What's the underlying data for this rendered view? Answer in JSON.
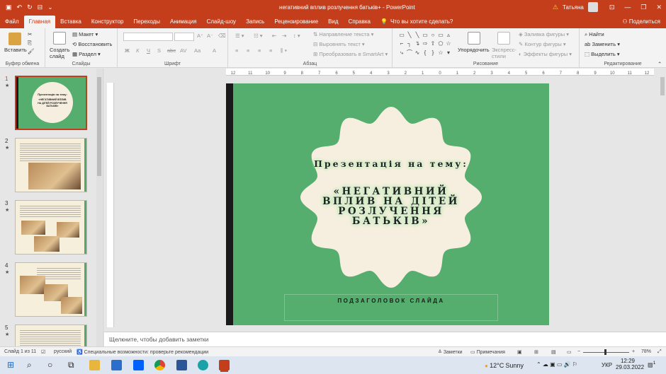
{
  "app": {
    "title": "негативний вплив розлучення батьків+ - PowerPoint",
    "user": "Татьяна"
  },
  "tabs": [
    "Файл",
    "Главная",
    "Вставка",
    "Конструктор",
    "Переходы",
    "Анимация",
    "Слайд-шоу",
    "Запись",
    "Рецензирование",
    "Вид",
    "Справка"
  ],
  "tell_me": "Что вы хотите сделать?",
  "share": "Поделиться",
  "ribbon": {
    "clipboard": {
      "paste": "Вставить",
      "label": "Буфер обмена"
    },
    "slides": {
      "new_slide": "Создать слайд",
      "layout": "Макет",
      "reset": "Восстановить",
      "section": "Раздел",
      "label": "Слайды"
    },
    "font": {
      "label": "Шрифт",
      "bold": "Ж",
      "italic": "К",
      "underline": "Ч",
      "strike": "S",
      "spacing": "AV",
      "case": "Aa",
      "color": "A"
    },
    "paragraph": {
      "label": "Абзац",
      "text_direction": "Направление текста",
      "align_text": "Выровнять текст",
      "smartart": "Преобразовать в SmartArt"
    },
    "drawing": {
      "label": "Рисование",
      "arrange": "Упорядочить",
      "quick_styles": "Экспресс-стили",
      "fill": "Заливка фигуры",
      "outline": "Контур фигуры",
      "effects": "Эффекты фигуры"
    },
    "editing": {
      "label": "Редактирование",
      "find": "Найти",
      "replace": "Заменить",
      "select": "Выделить"
    }
  },
  "ruler_ticks": [
    "12",
    "11",
    "10",
    "9",
    "8",
    "7",
    "6",
    "5",
    "4",
    "3",
    "2",
    "1",
    "0",
    "1",
    "2",
    "3",
    "4",
    "5",
    "6",
    "7",
    "8",
    "9",
    "10",
    "11",
    "12"
  ],
  "slide": {
    "presentation_on": "Презентація на тему:",
    "title_lines": [
      "«НЕГАТИВНИЙ",
      "ВПЛИВ НА ДІТЕЙ",
      "РОЗЛУЧЕННЯ",
      "БАТЬКІВ»"
    ],
    "subtitle": "ПОДЗАГОЛОВОК СЛАЙДА",
    "colors": {
      "background": "#55ae6e",
      "scallop": "#f6efdf",
      "bar": "#1a1a1a"
    }
  },
  "thumbnails": [
    {
      "num": "1",
      "mini_title": "Презентація на тему:",
      "mini_main": "«НЕГАТИВНИЙ ВПЛИВ НА ДІТЕЙ РОЗЛУЧЕННЯ БАТЬКІВ»"
    },
    {
      "num": "2"
    },
    {
      "num": "3"
    },
    {
      "num": "4"
    },
    {
      "num": "5"
    }
  ],
  "notes_placeholder": "Щелкните, чтобы добавить заметки",
  "status": {
    "slide_of": "Слайд 1 из 11",
    "language": "русский",
    "accessibility": "Специальные возможности: проверьте рекомендации",
    "notes": "Заметки",
    "comments": "Примечания",
    "zoom": "78%",
    "zoom_level": 78
  },
  "taskbar": {
    "weather_temp": "12°C",
    "weather_text": "Sunny",
    "lang": "УКР",
    "time": "12:29",
    "date": "29.03.2022",
    "notifications": "1"
  }
}
